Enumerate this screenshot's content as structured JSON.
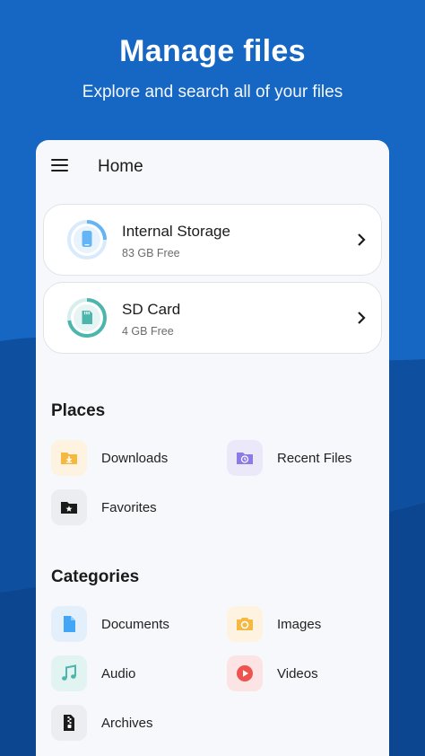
{
  "header": {
    "title": "Manage files",
    "subtitle": "Explore and search all of your files"
  },
  "appbar": {
    "title": "Home"
  },
  "storage": [
    {
      "name": "Internal Storage",
      "free": "83 GB Free",
      "icon": "phone-icon",
      "color": "#64b5f6"
    },
    {
      "name": "SD Card",
      "free": "4 GB Free",
      "icon": "sd-card-icon",
      "color": "#4db6ac"
    }
  ],
  "places": {
    "title": "Places",
    "items": [
      {
        "label": "Downloads",
        "icon": "download-folder-icon",
        "color": "#f5b942"
      },
      {
        "label": "Recent Files",
        "icon": "recent-folder-icon",
        "color": "#8c7ae6"
      },
      {
        "label": "Favorites",
        "icon": "star-folder-icon",
        "color": "#1b1b1b"
      }
    ]
  },
  "categories": {
    "title": "Categories",
    "items": [
      {
        "label": "Documents",
        "icon": "document-icon",
        "color": "#42a5f5"
      },
      {
        "label": "Images",
        "icon": "camera-icon",
        "color": "#f5b942"
      },
      {
        "label": "Audio",
        "icon": "music-note-icon",
        "color": "#4db6ac"
      },
      {
        "label": "Videos",
        "icon": "play-icon",
        "color": "#ef5350"
      },
      {
        "label": "Archives",
        "icon": "archive-icon",
        "color": "#1b1b1b"
      }
    ]
  },
  "colors": {
    "background_blue": "#1666c4",
    "background_dark": "#0f4c9c",
    "card_bg": "#ffffff",
    "panel_bg": "#f7f8fb"
  }
}
